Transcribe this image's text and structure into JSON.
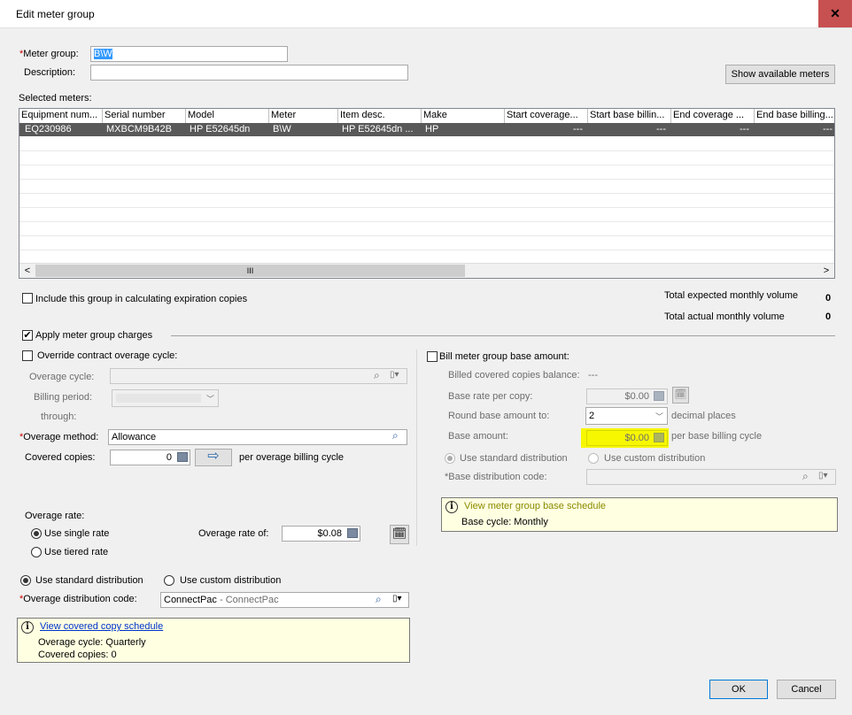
{
  "window": {
    "title": "Edit meter group",
    "close": "✕"
  },
  "meter_group": {
    "label": "Meter group:",
    "required_mark": "*",
    "value": "B\\W"
  },
  "description": {
    "label": "Description:",
    "value": ""
  },
  "show_meters_btn": "Show available meters",
  "selected_meters_label": "Selected meters:",
  "grid": {
    "columns": [
      "Equipment num...",
      "Serial number",
      "Model",
      "Meter",
      "Item desc.",
      "Make",
      "Start coverage...",
      "Start base billin...",
      "End coverage ...",
      "End base billing..."
    ],
    "row": [
      "EQ230986",
      "MXBCM9B42B",
      "HP E52645dn",
      "B\\W",
      "HP E52645dn ...",
      "HP",
      "---",
      "---",
      "---",
      "---"
    ],
    "scroll_left": "<",
    "scroll_right": ">",
    "scroll_thumb": "III"
  },
  "include_group": {
    "label": "Include this group in calculating expiration copies",
    "checked": false
  },
  "totals": {
    "expected_label": "Total expected monthly volume",
    "expected_value": "0",
    "actual_label": "Total actual monthly volume",
    "actual_value": "0"
  },
  "apply_charges": {
    "label": "Apply meter group charges",
    "check": "✔"
  },
  "override": {
    "label": "Override contract overage cycle:"
  },
  "overage_cycle_label": "Overage cycle:",
  "billing_period_label": "Billing period:",
  "through_label": "through:",
  "overage_method": {
    "label": "Overage method:",
    "required_mark": "*",
    "value": "Allowance"
  },
  "covered_copies": {
    "label": "Covered copies:",
    "value": "0",
    "suffix": "per overage billing cycle"
  },
  "overage_rate": {
    "label": "Overage rate:",
    "single": "Use single rate",
    "tiered": "Use tiered rate",
    "rate_of_label": "Overage rate of:",
    "rate_of_value": "$0.08"
  },
  "distribution": {
    "standard": "Use standard distribution",
    "custom": "Use custom distribution"
  },
  "overage_dist_code": {
    "label": "Overage distribution code:",
    "required_mark": "*",
    "value": "ConnectPac",
    "secondary": " - ConnectPac"
  },
  "covered_schedule": {
    "link": "View covered copy schedule",
    "line1": "Overage cycle: Quarterly",
    "line2": "Covered copies: 0"
  },
  "bill_base": {
    "label": "Bill meter group base amount:",
    "balance_label": "Billed covered copies balance:",
    "balance_value": "---",
    "rate_label": "Base rate per copy:",
    "rate_value": "$0.00",
    "round_label": "Round base amount to:",
    "round_value": "2",
    "round_suffix": "decimal places",
    "amount_label": "Base amount:",
    "amount_value": "$0.00",
    "amount_suffix": "per base billing cycle",
    "std_dist": "Use standard distribution",
    "custom_dist": "Use custom distribution",
    "dist_code_label": "*Base distribution code:"
  },
  "base_schedule": {
    "link": "View meter group base schedule",
    "line1": "Base cycle: Monthly"
  },
  "buttons": {
    "ok": "OK",
    "cancel": "Cancel"
  },
  "colors": {
    "highlight": "#f7f700",
    "info_bg": "#ffffe1",
    "selected_row": "#595959"
  }
}
